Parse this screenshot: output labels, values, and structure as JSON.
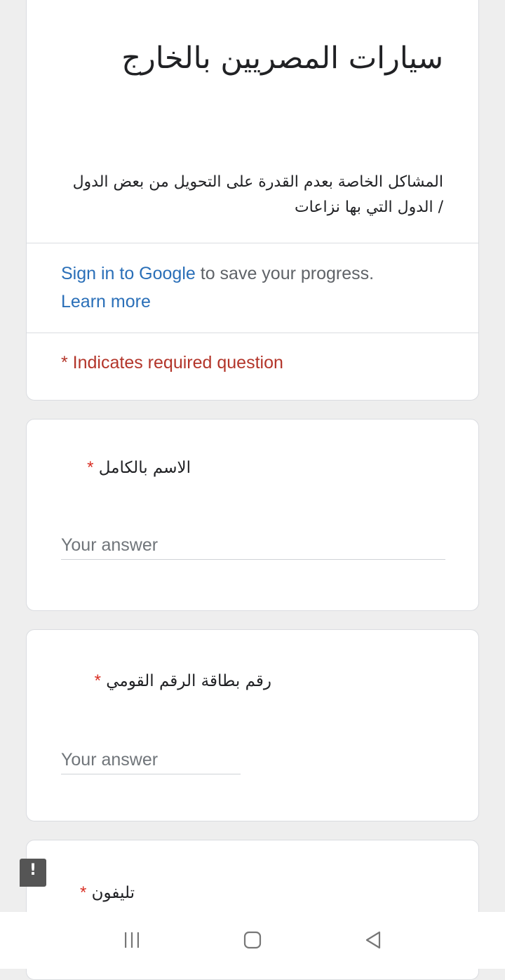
{
  "header": {
    "title": "سيارات المصريين بالخارج",
    "description": "المشاكل الخاصة بعدم القدرة على التحويل من بعض الدول / الدول التي بها نزاعات",
    "sign_in_link": "Sign in to Google",
    "sign_in_suffix": " to save your progress.",
    "learn_more": "Learn more",
    "required_note": "* Indicates required question",
    "accent_color": "#555555"
  },
  "questions": [
    {
      "title": "الاسم بالكامل",
      "required_mark": "*",
      "placeholder": "Your answer"
    },
    {
      "title": "رقم بطاقة الرقم القومي",
      "required_mark": "*",
      "placeholder": "Your answer"
    },
    {
      "title": "تليفون",
      "required_mark": "*"
    }
  ],
  "feedback": {
    "icon": "report-problem-icon",
    "glyph": "!"
  },
  "nav": {
    "recents_icon": "recent-apps-icon",
    "home_icon": "home-icon",
    "back_icon": "back-icon"
  },
  "colors": {
    "link": "#2a6fb8",
    "required": "#d93025",
    "background": "#eeeeee"
  }
}
